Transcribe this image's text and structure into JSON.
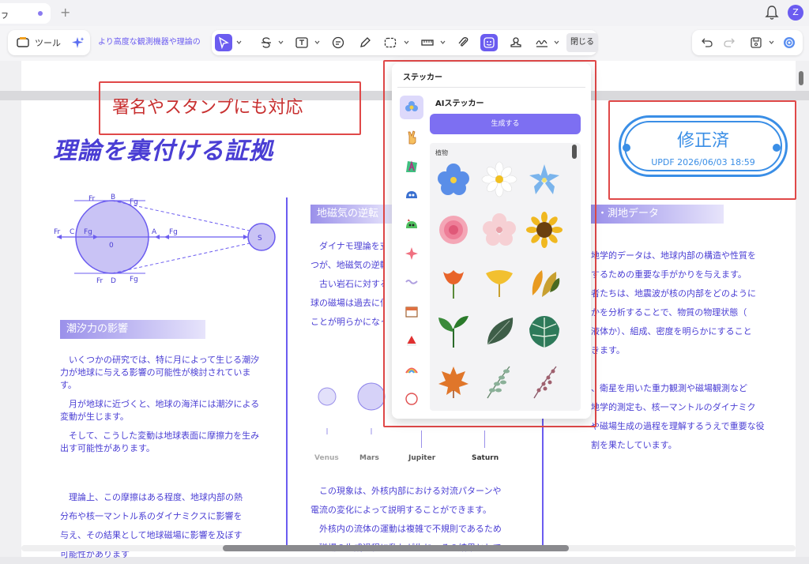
{
  "tabbar": {
    "tab_initial": "ㇷ",
    "add_tab": "+",
    "avatar_initial": "Z"
  },
  "toolbar": {
    "tools_label": "ツール",
    "breadcrumb_text": "より高度な観測機器や理論の",
    "close_label": "閉じる"
  },
  "document": {
    "title": "理論を裏付ける証拠",
    "sections": {
      "tide": "潮汐力の影響",
      "geomagnetic": "地磁気の逆転",
      "seismic": "・測地データ"
    },
    "diagram": {
      "labels": {
        "fr": "Fr",
        "fg": "Fg",
        "b": "B",
        "c": "C",
        "a": "A",
        "d": "D",
        "zero": "0",
        "s": "S"
      }
    },
    "left_col": {
      "p1": "いくつかの研究では、特に月によって生じる潮汐力が地球に与える影響の可能性が検討されています。",
      "p2": "月が地球に近づくと、地球の海洋には潮汐による変動が生じます。",
      "p3": "そして、こうした変動は地球表面に摩擦力を生み出す可能性があります。",
      "p4a": "理論上、この摩擦はある程度、地球内部の熱",
      "p4b": "分布や核一マントル系のダイナミクスに影響を",
      "p4c": "与え、その結果として地球磁場に影響を及ぼす",
      "p4d": "可能性があります"
    },
    "mid_col": {
      "l1": "ダイナモ理論を支",
      "l2": "つが、地磁気の逆転",
      "l3": "古い岩石に対する",
      "l4": "球の磁場は過去に何",
      "l5": "ことが明らかになっ",
      "planets": [
        "Venus",
        "Mars",
        "Jupiter",
        "Saturn"
      ],
      "b1": "この現象は、外核内部における対流パターンや",
      "b2": "電流の変化によって説明することができます。",
      "b3": "外核内の流体の運動は複雑で不規則であるため",
      "b4": "、磁場の生成過程に乱れが生じ、その結果として"
    },
    "right_col": {
      "l1": "地学的データは、地球内部の構造や性質を",
      "l2": "するための重要な手がかりを与えます。",
      "l3": "者たちは、地震波が核の内部をどのように",
      "l4": "かを分析することで、物質の物理状態（",
      "l5": "液体か）、組成、密度を明らかにすること",
      "l6": "きます。",
      "l7": "、衛星を用いた重力観測や磁場観測など",
      "l8": "地学的測定も、核一マントルのダイナミク",
      "l9": "や磁場生成の過程を理解するうえで重要な役",
      "l10": "割を果たしています。"
    }
  },
  "callout": {
    "text": "署名やスタンプにも対応"
  },
  "stamp": {
    "title": "修正済",
    "subtitle": "UPDF 2026/06/03 18:59",
    "color": "#3a8ee6"
  },
  "sticker_panel": {
    "title": "ステッカー",
    "ai_title": "AIステッカー",
    "generate_label": "生成する",
    "category_label": "植物",
    "accent": "#7d6ff2"
  }
}
